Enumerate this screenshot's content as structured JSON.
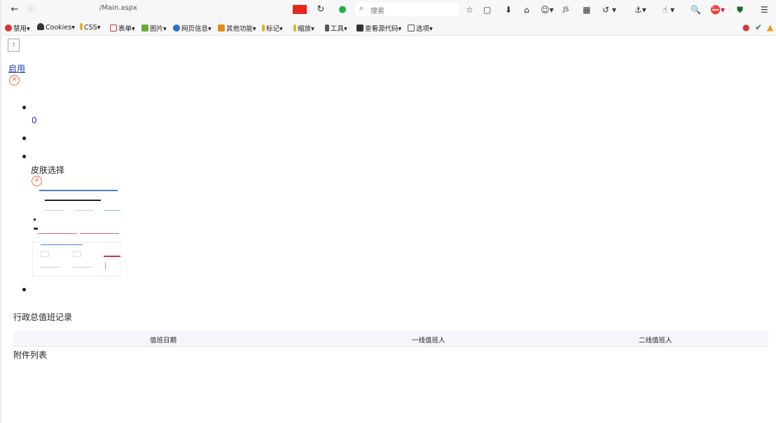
{
  "browser": {
    "url": "/Main.aspx",
    "search_placeholder": "搜索",
    "icons": {
      "back": "back-arrow-icon",
      "info": "info-icon",
      "reload": "reload-icon",
      "shield": "shield-icon",
      "search": "search-icon",
      "bookmark": "bookmark-star-icon",
      "download": "download-icon",
      "home": "home-icon",
      "menu": "hamburger-menu-icon"
    },
    "colors": {
      "flag": "#e8261c",
      "extension_green": "#22b14c"
    }
  },
  "bookmarks": {
    "items": [
      "禁用▾",
      "Cookies▾",
      "CSS▾",
      "表单▾",
      "图片▾",
      "网页信息▾",
      "其他功能▾",
      "标记▾",
      "缩放▾",
      "工具▾",
      "查看源代码▾",
      "选项▾"
    ]
  },
  "page": {
    "enable_link": "启用",
    "zero_value": "0",
    "skin_label": "皮肤选择",
    "section_title": "行政总值班记录",
    "table_headers": [
      "值班日期",
      "一线值班人",
      "二线值班人"
    ],
    "attachments_label": "附件列表"
  }
}
